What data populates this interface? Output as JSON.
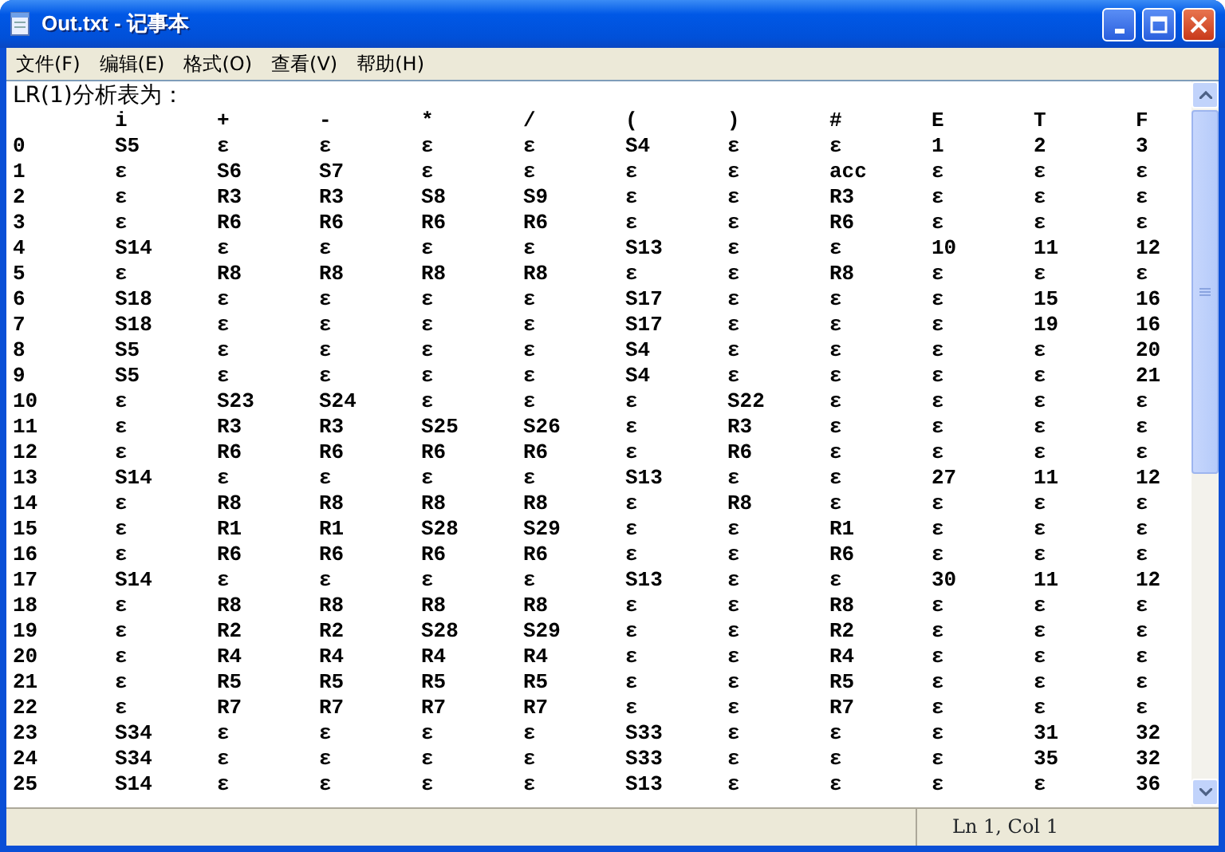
{
  "window": {
    "title": "Out.txt - 记事本"
  },
  "menu": [
    "文件(F)",
    "编辑(E)",
    "格式(O)",
    "查看(V)",
    "帮助(H)"
  ],
  "document": {
    "heading": "LR(1)分析表为：",
    "columns": [
      "i",
      "+",
      "-",
      "*",
      "/",
      "(",
      ")",
      "#",
      "E",
      "T",
      "F"
    ],
    "rows": [
      {
        "state": "0",
        "cells": [
          "S5",
          "ε",
          "ε",
          "ε",
          "ε",
          "S4",
          "ε",
          "ε",
          "1",
          "2",
          "3"
        ]
      },
      {
        "state": "1",
        "cells": [
          "ε",
          "S6",
          "S7",
          "ε",
          "ε",
          "ε",
          "ε",
          "acc",
          "ε",
          "ε",
          "ε"
        ]
      },
      {
        "state": "2",
        "cells": [
          "ε",
          "R3",
          "R3",
          "S8",
          "S9",
          "ε",
          "ε",
          "R3",
          "ε",
          "ε",
          "ε"
        ]
      },
      {
        "state": "3",
        "cells": [
          "ε",
          "R6",
          "R6",
          "R6",
          "R6",
          "ε",
          "ε",
          "R6",
          "ε",
          "ε",
          "ε"
        ]
      },
      {
        "state": "4",
        "cells": [
          "S14",
          "ε",
          "ε",
          "ε",
          "ε",
          "S13",
          "ε",
          "ε",
          "10",
          "11",
          "12"
        ]
      },
      {
        "state": "5",
        "cells": [
          "ε",
          "R8",
          "R8",
          "R8",
          "R8",
          "ε",
          "ε",
          "R8",
          "ε",
          "ε",
          "ε"
        ]
      },
      {
        "state": "6",
        "cells": [
          "S18",
          "ε",
          "ε",
          "ε",
          "ε",
          "S17",
          "ε",
          "ε",
          "ε",
          "15",
          "16"
        ]
      },
      {
        "state": "7",
        "cells": [
          "S18",
          "ε",
          "ε",
          "ε",
          "ε",
          "S17",
          "ε",
          "ε",
          "ε",
          "19",
          "16"
        ]
      },
      {
        "state": "8",
        "cells": [
          "S5",
          "ε",
          "ε",
          "ε",
          "ε",
          "S4",
          "ε",
          "ε",
          "ε",
          "ε",
          "20"
        ]
      },
      {
        "state": "9",
        "cells": [
          "S5",
          "ε",
          "ε",
          "ε",
          "ε",
          "S4",
          "ε",
          "ε",
          "ε",
          "ε",
          "21"
        ]
      },
      {
        "state": "10",
        "cells": [
          "ε",
          "S23",
          "S24",
          "ε",
          "ε",
          "ε",
          "S22",
          "ε",
          "ε",
          "ε",
          "ε"
        ]
      },
      {
        "state": "11",
        "cells": [
          "ε",
          "R3",
          "R3",
          "S25",
          "S26",
          "ε",
          "R3",
          "ε",
          "ε",
          "ε",
          "ε"
        ]
      },
      {
        "state": "12",
        "cells": [
          "ε",
          "R6",
          "R6",
          "R6",
          "R6",
          "ε",
          "R6",
          "ε",
          "ε",
          "ε",
          "ε"
        ]
      },
      {
        "state": "13",
        "cells": [
          "S14",
          "ε",
          "ε",
          "ε",
          "ε",
          "S13",
          "ε",
          "ε",
          "27",
          "11",
          "12"
        ]
      },
      {
        "state": "14",
        "cells": [
          "ε",
          "R8",
          "R8",
          "R8",
          "R8",
          "ε",
          "R8",
          "ε",
          "ε",
          "ε",
          "ε"
        ]
      },
      {
        "state": "15",
        "cells": [
          "ε",
          "R1",
          "R1",
          "S28",
          "S29",
          "ε",
          "ε",
          "R1",
          "ε",
          "ε",
          "ε"
        ]
      },
      {
        "state": "16",
        "cells": [
          "ε",
          "R6",
          "R6",
          "R6",
          "R6",
          "ε",
          "ε",
          "R6",
          "ε",
          "ε",
          "ε"
        ]
      },
      {
        "state": "17",
        "cells": [
          "S14",
          "ε",
          "ε",
          "ε",
          "ε",
          "S13",
          "ε",
          "ε",
          "30",
          "11",
          "12"
        ]
      },
      {
        "state": "18",
        "cells": [
          "ε",
          "R8",
          "R8",
          "R8",
          "R8",
          "ε",
          "ε",
          "R8",
          "ε",
          "ε",
          "ε"
        ]
      },
      {
        "state": "19",
        "cells": [
          "ε",
          "R2",
          "R2",
          "S28",
          "S29",
          "ε",
          "ε",
          "R2",
          "ε",
          "ε",
          "ε"
        ]
      },
      {
        "state": "20",
        "cells": [
          "ε",
          "R4",
          "R4",
          "R4",
          "R4",
          "ε",
          "ε",
          "R4",
          "ε",
          "ε",
          "ε"
        ]
      },
      {
        "state": "21",
        "cells": [
          "ε",
          "R5",
          "R5",
          "R5",
          "R5",
          "ε",
          "ε",
          "R5",
          "ε",
          "ε",
          "ε"
        ]
      },
      {
        "state": "22",
        "cells": [
          "ε",
          "R7",
          "R7",
          "R7",
          "R7",
          "ε",
          "ε",
          "R7",
          "ε",
          "ε",
          "ε"
        ]
      },
      {
        "state": "23",
        "cells": [
          "S34",
          "ε",
          "ε",
          "ε",
          "ε",
          "S33",
          "ε",
          "ε",
          "ε",
          "31",
          "32"
        ]
      },
      {
        "state": "24",
        "cells": [
          "S34",
          "ε",
          "ε",
          "ε",
          "ε",
          "S33",
          "ε",
          "ε",
          "ε",
          "35",
          "32"
        ]
      },
      {
        "state": "25",
        "cells": [
          "S14",
          "ε",
          "ε",
          "ε",
          "ε",
          "S13",
          "ε",
          "ε",
          "ε",
          "ε",
          "36"
        ]
      }
    ]
  },
  "status_bar": {
    "position": "Ln 1, Col 1"
  }
}
